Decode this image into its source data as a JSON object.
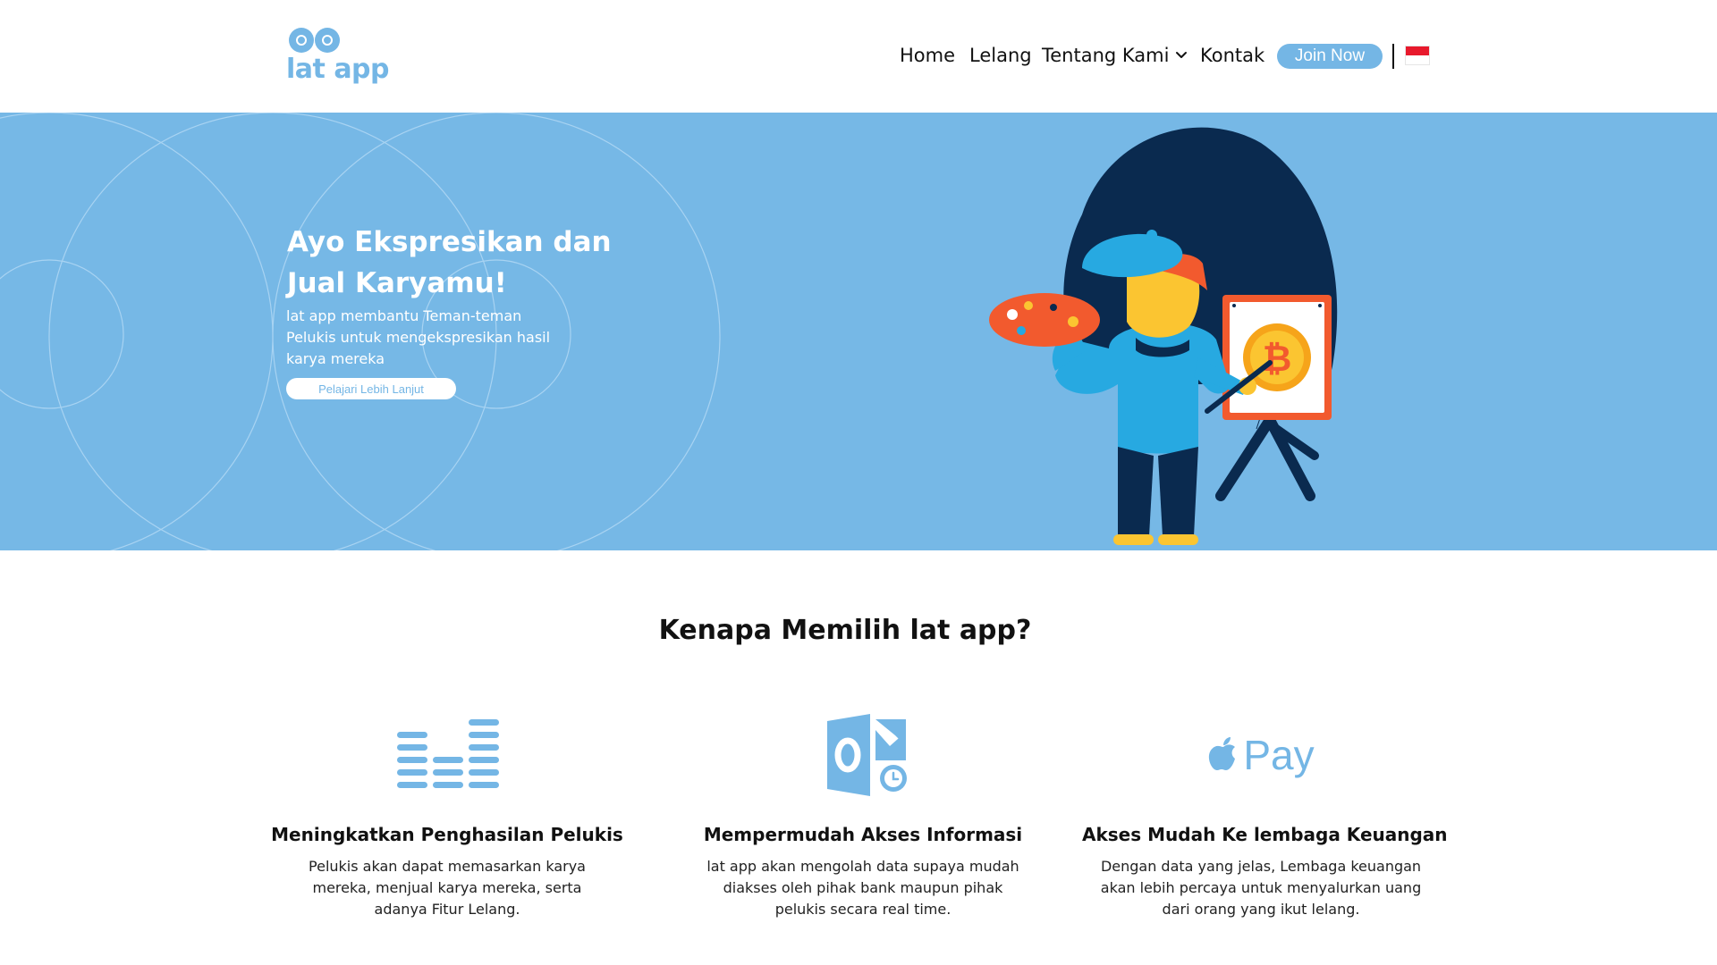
{
  "brand": {
    "name": "lat app",
    "color": "#74b6e5"
  },
  "nav": {
    "home": "Home",
    "lelang": "Lelang",
    "tentang": "Tentang Kami",
    "kontak": "Kontak",
    "join": "Join Now",
    "language_flag": "indonesia-flag-icon"
  },
  "hero": {
    "title": "Ayo Ekspresikan dan Jual Karyamu!",
    "subtitle": "lat app membantu Teman-teman Pelukis untuk mengekspresikan hasil karya mereka",
    "cta": "Pelajari Lebih Lanjut",
    "background": "#76b8e6"
  },
  "why": {
    "title": "Kenapa Memilih lat app?",
    "features": [
      {
        "icon": "equalizer-bars-icon",
        "title": "Meningkatkan Penghasilan Pelukis",
        "desc": "Pelukis akan dapat memasarkan karya mereka, menjual karya mereka, serta adanya Fitur Lelang."
      },
      {
        "icon": "outlook-icon",
        "title": "Mempermudah Akses Informasi",
        "desc": "lat app akan mengolah data supaya mudah diakses oleh pihak bank maupun pihak pelukis secara real time."
      },
      {
        "icon": "apple-pay-icon",
        "icon_text": "Pay",
        "title": "Akses Mudah Ke lembaga Keuangan",
        "desc": "Dengan data yang jelas, Lembaga keuangan akan lebih percaya untuk menyalurkan uang dari orang yang ikut lelang."
      }
    ]
  }
}
